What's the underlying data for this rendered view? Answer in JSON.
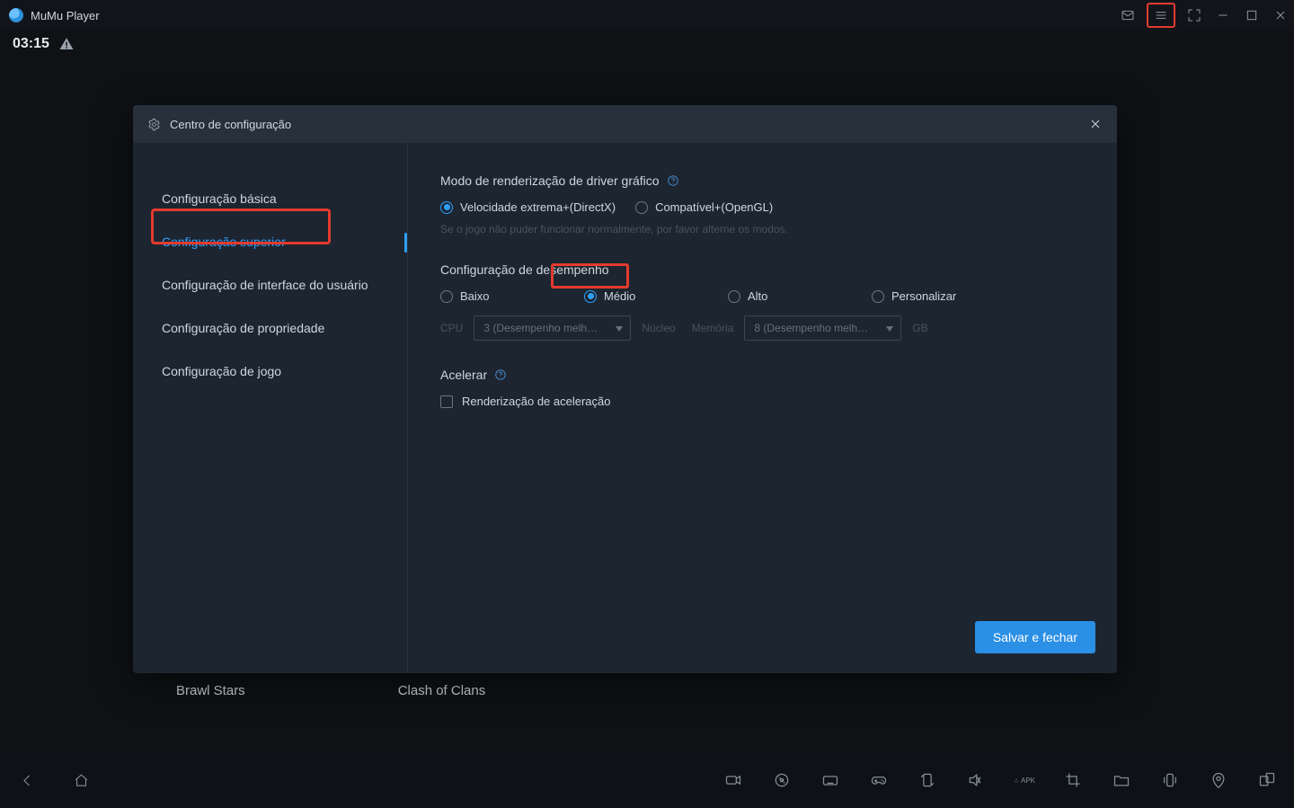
{
  "titlebar": {
    "app_name": "MuMu Player"
  },
  "status": {
    "time": "03:15"
  },
  "tiles": {
    "brawl": "Brawl Stars",
    "clash": "Clash of Clans"
  },
  "dialog": {
    "title": "Centro de configuração",
    "sidebar": {
      "items": [
        {
          "label": "Configuração básica"
        },
        {
          "label": "Configuração superior"
        },
        {
          "label": "Configuração de interface do usuário"
        },
        {
          "label": "Configuração de propriedade"
        },
        {
          "label": "Configuração de jogo"
        }
      ],
      "active_index": 1
    },
    "sections": {
      "render": {
        "title": "Modo de renderização de driver gráfico",
        "options": [
          {
            "label": "Velocidade extrema+(DirectX)",
            "selected": true
          },
          {
            "label": "Compatível+(OpenGL)",
            "selected": false
          }
        ],
        "hint": "Se o jogo não puder funcionar normalmente, por favor alterne os modos."
      },
      "performance": {
        "title": "Configuração de desempenho",
        "options": [
          {
            "label": "Baixo",
            "selected": false
          },
          {
            "label": "Médio",
            "selected": true
          },
          {
            "label": "Alto",
            "selected": false
          },
          {
            "label": "Personalizar",
            "selected": false
          }
        ],
        "cpu": {
          "label": "CPU",
          "select_text": "3 (Desempenho melh…",
          "core_label": "Núcleo"
        },
        "mem": {
          "label": "Memória",
          "select_text": "8 (Desempenho melh…",
          "gb_label": "GB"
        }
      },
      "accelerate": {
        "title": "Acelerar",
        "checkbox_label": "Renderização de aceleração",
        "checked": false
      }
    },
    "save_button": "Salvar e fechar"
  },
  "toolbar_apk": "APK"
}
